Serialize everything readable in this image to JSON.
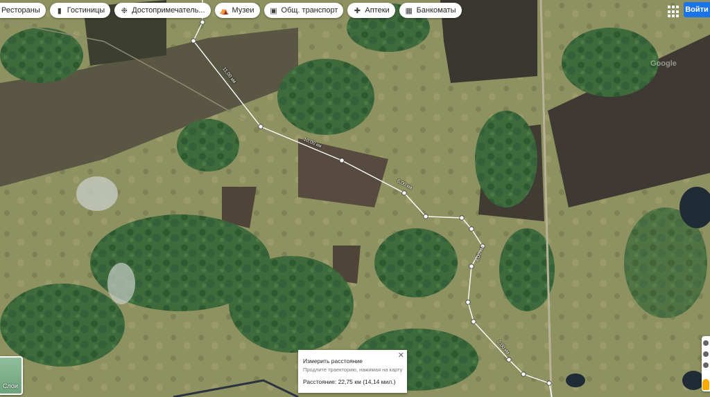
{
  "chips": [
    {
      "label": "Рестораны",
      "icon": "restaurant-icon"
    },
    {
      "label": "Гостиницы",
      "icon": "hotel-icon"
    },
    {
      "label": "Достопримечатель...",
      "icon": "attractions-icon"
    },
    {
      "label": "Музеи",
      "icon": "museum-icon"
    },
    {
      "label": "Общ. транспорт",
      "icon": "transit-icon"
    },
    {
      "label": "Аптеки",
      "icon": "pharmacy-icon"
    },
    {
      "label": "Банкоматы",
      "icon": "atm-icon"
    }
  ],
  "header": {
    "login_label": "Войти"
  },
  "layers": {
    "label": "Слои"
  },
  "watermark": "Google",
  "measure": {
    "title": "Измерить расстояние",
    "hint": "Продлите траекторию, нажимая на карту",
    "distance": "Расстояние: 22,75 км (14,14 мил.)"
  },
  "route_segments": [
    {
      "label": "11,00 км"
    },
    {
      "label": "10,00 км"
    },
    {
      "label": "6,00 км"
    },
    {
      "label": "4,00 км"
    },
    {
      "label": "2,00 км"
    }
  ]
}
